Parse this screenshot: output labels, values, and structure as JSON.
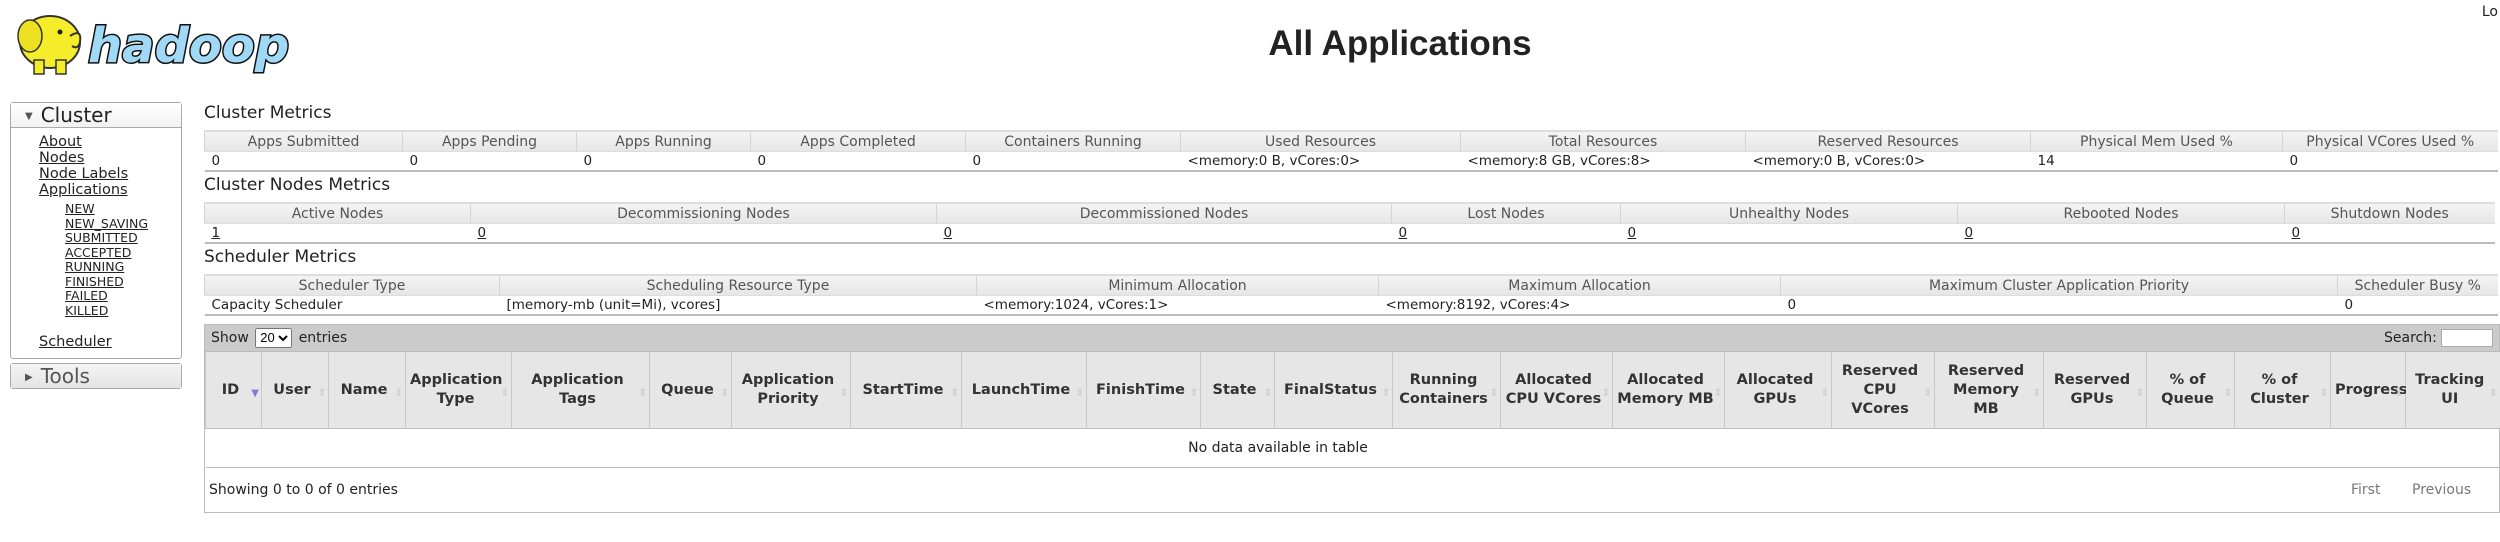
{
  "header": {
    "logo_text": "hadoop",
    "title": "All Applications",
    "user_text": "Lo"
  },
  "nav": {
    "cluster_label": "Cluster",
    "items": [
      "About",
      "Nodes",
      "Node Labels",
      "Applications"
    ],
    "app_states": [
      "NEW",
      "NEW_SAVING",
      "SUBMITTED",
      "ACCEPTED",
      "RUNNING",
      "FINISHED",
      "FAILED",
      "KILLED"
    ],
    "scheduler": "Scheduler",
    "tools_label": "Tools"
  },
  "cluster_metrics": {
    "title": "Cluster Metrics",
    "headers": [
      "Apps Submitted",
      "Apps Pending",
      "Apps Running",
      "Apps Completed",
      "Containers Running",
      "Used Resources",
      "Total Resources",
      "Reserved Resources",
      "Physical Mem Used %",
      "Physical VCores Used %"
    ],
    "values": [
      "0",
      "0",
      "0",
      "0",
      "0",
      "<memory:0 B, vCores:0>",
      "<memory:8 GB, vCores:8>",
      "<memory:0 B, vCores:0>",
      "14",
      "0"
    ]
  },
  "node_metrics": {
    "title": "Cluster Nodes Metrics",
    "headers": [
      "Active Nodes",
      "Decommissioning Nodes",
      "Decommissioned Nodes",
      "Lost Nodes",
      "Unhealthy Nodes",
      "Rebooted Nodes",
      "Shutdown Nodes"
    ],
    "values": [
      "1",
      "0",
      "0",
      "0",
      "0",
      "0",
      "0"
    ]
  },
  "scheduler_metrics": {
    "title": "Scheduler Metrics",
    "headers": [
      "Scheduler Type",
      "Scheduling Resource Type",
      "Minimum Allocation",
      "Maximum Allocation",
      "Maximum Cluster Application Priority",
      "Scheduler Busy %"
    ],
    "values": [
      "Capacity Scheduler",
      "[memory-mb (unit=Mi), vcores]",
      "<memory:1024, vCores:1>",
      "<memory:8192, vCores:4>",
      "0",
      "0"
    ]
  },
  "apps_table": {
    "show_label": "Show",
    "entries_label": "entries",
    "page_size": "20",
    "search_label": "Search:",
    "columns": [
      "ID",
      "User",
      "Name",
      "Application Type",
      "Application Tags",
      "Queue",
      "Application Priority",
      "StartTime",
      "LaunchTime",
      "FinishTime",
      "State",
      "FinalStatus",
      "Running Containers",
      "Allocated CPU VCores",
      "Allocated Memory MB",
      "Allocated GPUs",
      "Reserved CPU VCores",
      "Reserved Memory MB",
      "Reserved GPUs",
      "% of Queue",
      "% of Cluster",
      "Progress",
      "Tracking UI"
    ],
    "sorted_column": "ID",
    "empty_text": "No data available in table",
    "info": "Showing 0 to 0 of 0 entries",
    "first": "First",
    "previous": "Previous"
  },
  "colors": {
    "sort_active": "#7a7fd6",
    "toolbar": "#cbcbcb",
    "header_bg": "#e6e6e6"
  }
}
